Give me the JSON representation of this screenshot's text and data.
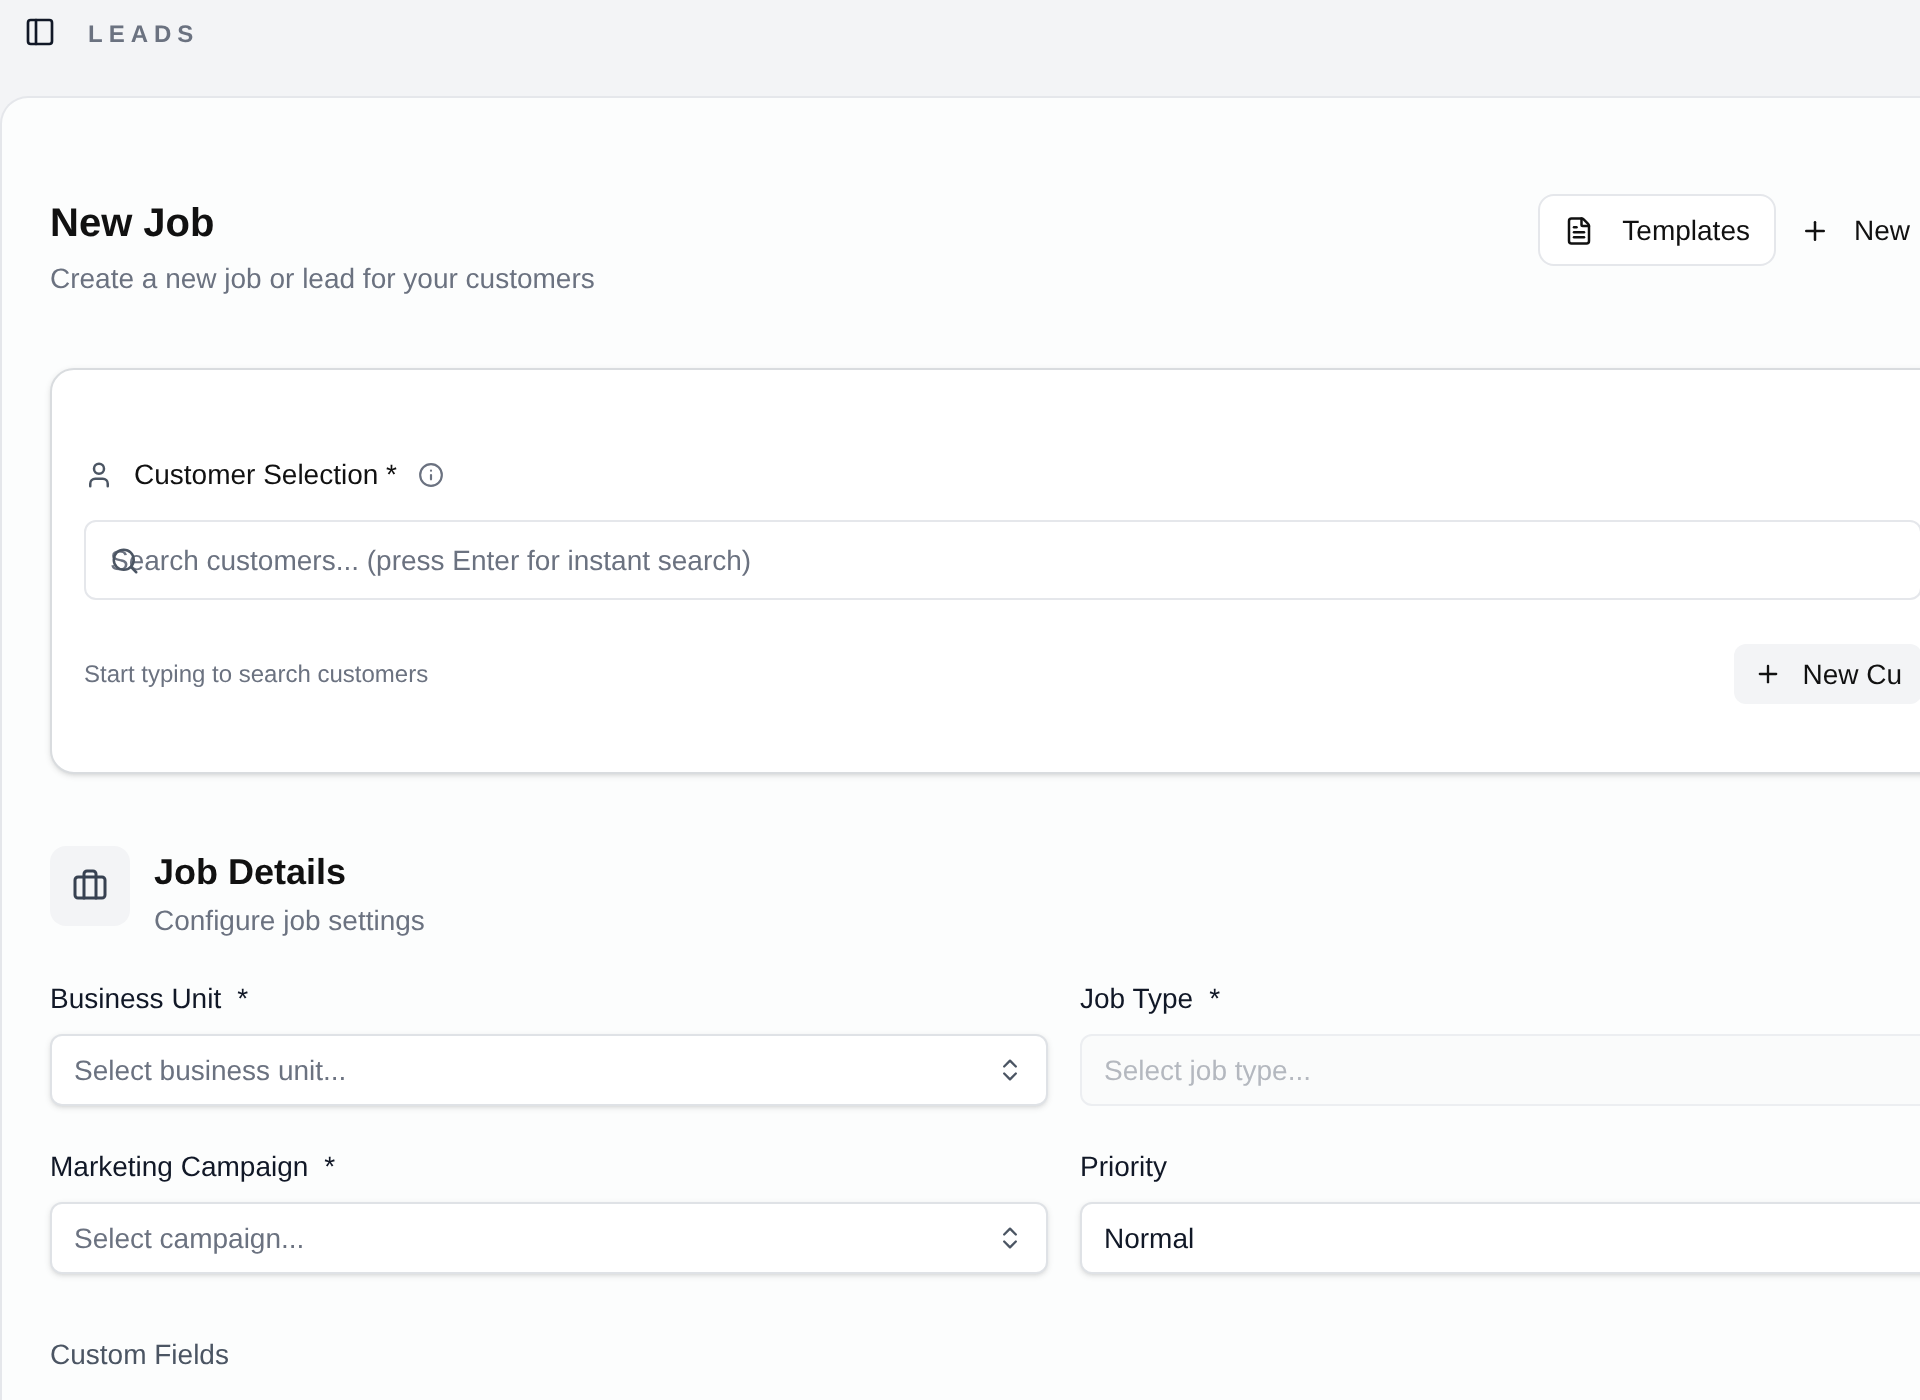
{
  "topbar": {
    "title": "LEADS"
  },
  "header": {
    "title": "New Job",
    "subtitle": "Create a new job or lead for your customers",
    "buttons": [
      {
        "kind": "templates",
        "label": "Templates"
      },
      {
        "kind": "new",
        "label": "New"
      }
    ]
  },
  "customer": {
    "label": "Customer Selection *",
    "search": {
      "placeholder": "Search customers... (press Enter for instant search)"
    },
    "hint": "Start typing to search customers",
    "button": "New Cu"
  },
  "job_details": {
    "title": "Job Details",
    "subtitle": "Configure job settings",
    "fields": [
      {
        "label": "Business Unit",
        "required": "*",
        "kind": "select",
        "placeholder": "Select business unit...",
        "disabled": false
      },
      {
        "label": "Job Type",
        "required": "*",
        "kind": "select",
        "placeholder": "Select job type...",
        "disabled": true
      },
      {
        "label": "Marketing Campaign",
        "required": "*",
        "kind": "select",
        "placeholder": "Select campaign...",
        "disabled": false
      },
      {
        "label": "Priority",
        "kind": "value",
        "value": "Normal",
        "disabled": false
      }
    ]
  },
  "custom_fields": {
    "title": "Custom Fields"
  }
}
